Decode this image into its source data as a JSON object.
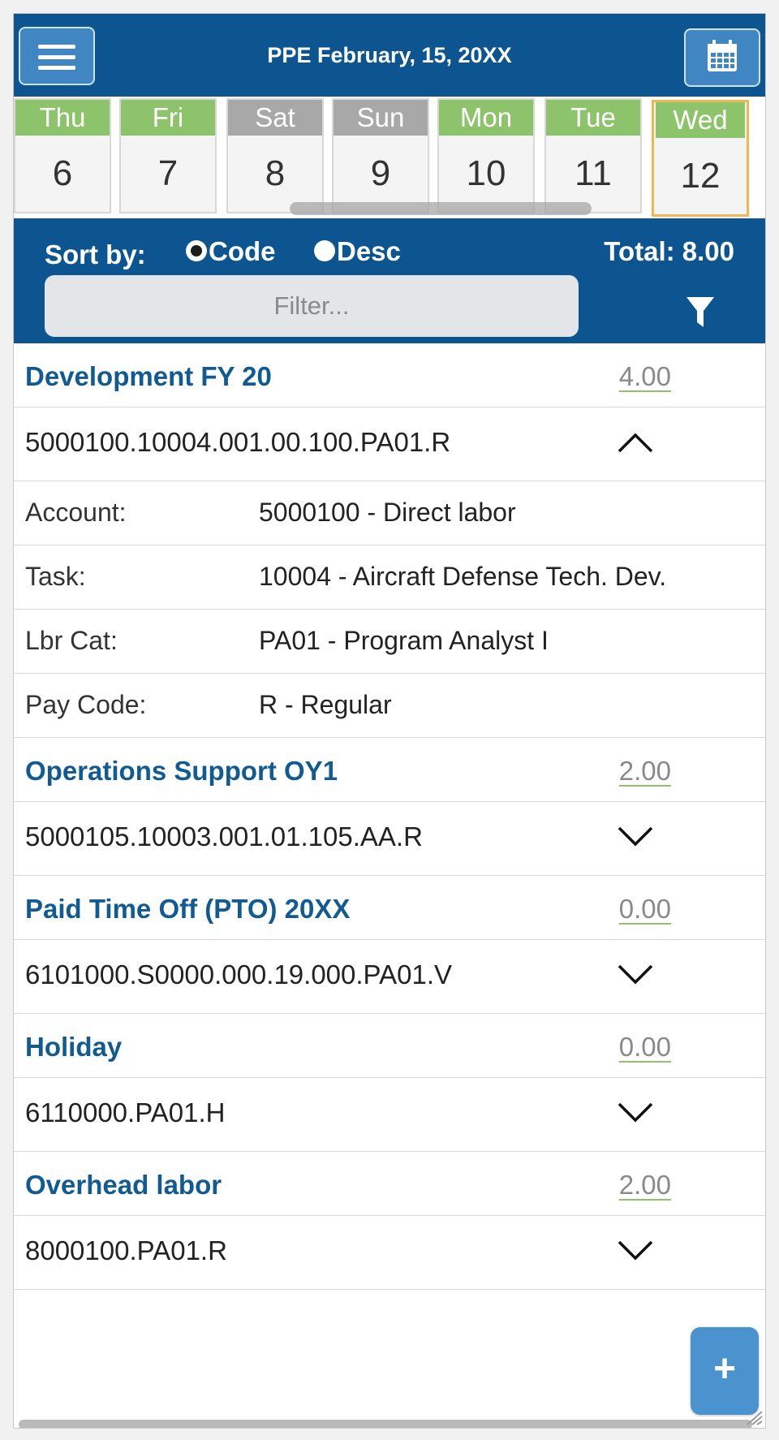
{
  "header": {
    "title": "PPE February, 15, 20XX",
    "menu_icon": "hamburger-menu-icon",
    "calendar_icon": "calendar-icon"
  },
  "days": [
    {
      "name": "Thu",
      "num": "6",
      "status": "green"
    },
    {
      "name": "Fri",
      "num": "7",
      "status": "green"
    },
    {
      "name": "Sat",
      "num": "8",
      "status": "gray"
    },
    {
      "name": "Sun",
      "num": "9",
      "status": "gray"
    },
    {
      "name": "Mon",
      "num": "10",
      "status": "green"
    },
    {
      "name": "Tue",
      "num": "11",
      "status": "green"
    },
    {
      "name": "Wed",
      "num": "12",
      "status": "green",
      "selected": true
    }
  ],
  "sort": {
    "label": "Sort by:",
    "options": [
      "Code",
      "Desc"
    ],
    "selected": "Code"
  },
  "total": "Total: 8.00",
  "filter": {
    "placeholder": "Filter...",
    "icon": "filter-icon"
  },
  "groups": [
    {
      "title": "Development FY 20",
      "hours": "4.00",
      "code": "5000100.10004.001.00.100.PA01.R",
      "expanded": true,
      "details": [
        {
          "label": "Account:",
          "value": "5000100 - Direct labor"
        },
        {
          "label": "Task:",
          "value": "10004 - Aircraft Defense Tech. Dev."
        },
        {
          "label": "Lbr Cat:",
          "value": "PA01 - Program Analyst I"
        },
        {
          "label": "Pay Code:",
          "value": "R - Regular"
        }
      ]
    },
    {
      "title": "Operations Support OY1",
      "hours": "2.00",
      "code": "5000105.10003.001.01.105.AA.R",
      "expanded": false
    },
    {
      "title": "Paid Time Off (PTO) 20XX",
      "hours": "0.00",
      "code": "6101000.S0000.000.19.000.PA01.V",
      "expanded": false
    },
    {
      "title": "Holiday",
      "hours": "0.00",
      "code": "6110000.PA01.H",
      "expanded": false
    },
    {
      "title": "Overhead labor",
      "hours": "2.00",
      "code": "8000100.PA01.R",
      "expanded": false
    }
  ],
  "fab": {
    "label": "+",
    "icon": "plus-icon"
  },
  "colors": {
    "header_blue": "#0d5590",
    "button_blue": "#3f86c2",
    "day_green": "#8dc36a",
    "day_gray": "#a8a8a8",
    "selected_border": "#f0b74c",
    "group_title": "#125b92"
  }
}
